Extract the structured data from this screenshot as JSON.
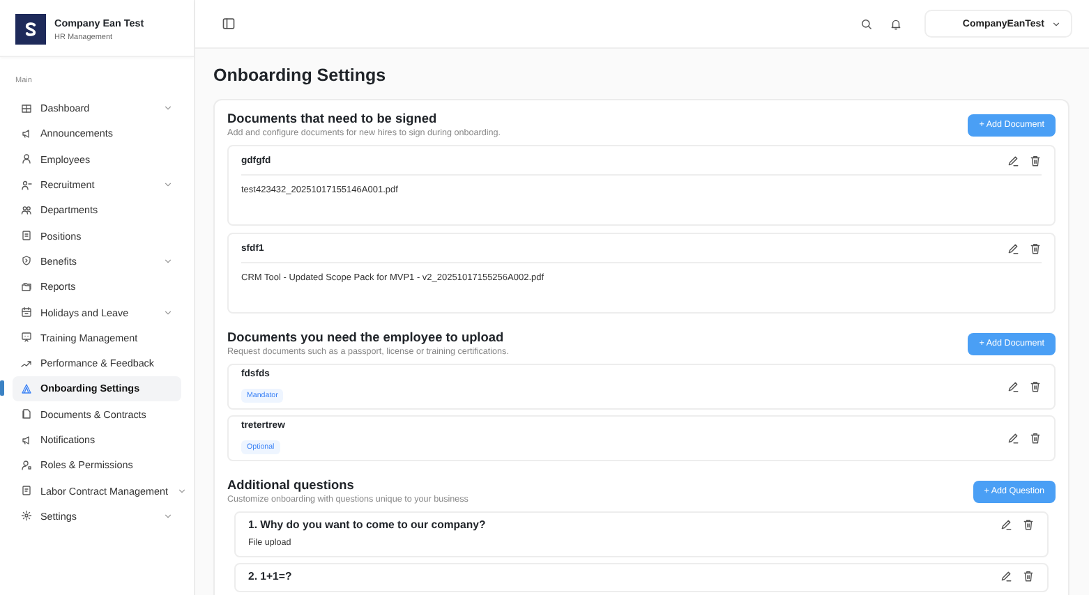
{
  "sidebar": {
    "company": "Company Ean Test",
    "subtitle": "HR Management",
    "section_label": "Main",
    "items": [
      {
        "label": "Dashboard",
        "selected": false,
        "has_submenu": true
      },
      {
        "label": "Announcements",
        "selected": false,
        "has_submenu": false
      },
      {
        "label": "Employees",
        "selected": false,
        "has_submenu": false
      },
      {
        "label": "Recruitment",
        "selected": false,
        "has_submenu": true
      },
      {
        "label": "Departments",
        "selected": false,
        "has_submenu": false
      },
      {
        "label": "Positions",
        "selected": false,
        "has_submenu": false
      },
      {
        "label": "Benefits",
        "selected": false,
        "has_submenu": true
      },
      {
        "label": "Reports",
        "selected": false,
        "has_submenu": false
      },
      {
        "label": "Holidays and Leave",
        "selected": false,
        "has_submenu": true
      },
      {
        "label": "Training Management",
        "selected": false,
        "has_submenu": false
      },
      {
        "label": "Performance & Feedback",
        "selected": false,
        "has_submenu": false
      },
      {
        "label": "Onboarding Settings",
        "selected": true,
        "has_submenu": false
      },
      {
        "label": "Documents & Contracts",
        "selected": false,
        "has_submenu": false
      },
      {
        "label": "Notifications",
        "selected": false,
        "has_submenu": false
      },
      {
        "label": "Roles & Permissions",
        "selected": false,
        "has_submenu": false
      },
      {
        "label": "Labor Contract Management",
        "selected": false,
        "has_submenu": true
      },
      {
        "label": "Settings",
        "selected": false,
        "has_submenu": true
      }
    ]
  },
  "topbar": {
    "account": "CompanyEanTest"
  },
  "page_title": "Onboarding Settings",
  "signed_documents": {
    "title": "Documents that need to be signed",
    "description": "Add and configure documents for new hires to sign during onboarding.",
    "button": "+ Add Document",
    "items": [
      {
        "name": "gdfgfd",
        "file": "test423432_20251017155146A001.pdf"
      },
      {
        "name": "sfdf1",
        "file": "CRM Tool - Updated Scope Pack for MVP1 - v2_20251017155256A002.pdf"
      }
    ]
  },
  "upload_documents": {
    "title": "Documents you need the employee to upload",
    "description": "Request documents such as a passport, license or training certifications.",
    "button": "+ Add Document",
    "items": [
      {
        "name": "fdsfds",
        "requirement": "Mandator"
      },
      {
        "name": "tretertrew",
        "requirement": "Optional"
      }
    ]
  },
  "questions": {
    "title": "Additional questions",
    "description": "Customize onboarding with questions unique to your business",
    "button": "+ Add Question",
    "items": [
      {
        "question": "1. Why do you want to come to our company?",
        "answer_type": "File upload"
      },
      {
        "question": "2. 1+1=?"
      }
    ]
  }
}
